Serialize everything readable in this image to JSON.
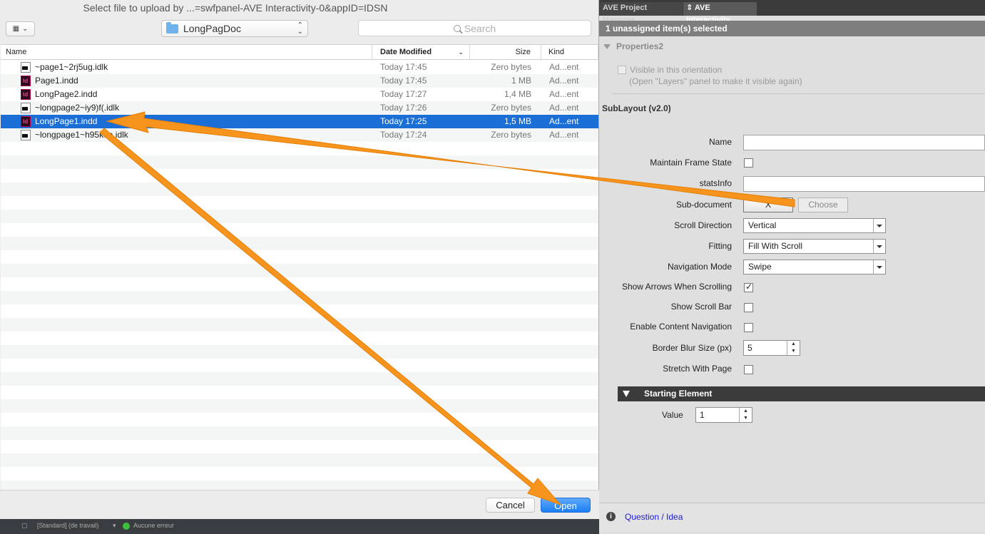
{
  "dialog": {
    "title": "Select file to upload by ...=swfpanel-AVE Interactivity-0&appID=IDSN",
    "location": "LongPagDoc",
    "search_placeholder": "Search",
    "columns": {
      "name": "Name",
      "date": "Date Modified",
      "size": "Size",
      "kind": "Kind"
    },
    "files": [
      {
        "name": "~page1~2rj5ug.idlk",
        "date": "Today 17:45",
        "size": "Zero bytes",
        "kind": "Ad...ent",
        "icon": "idlk-file-icon"
      },
      {
        "name": "Page1.indd",
        "date": "Today 17:45",
        "size": "1 MB",
        "kind": "Ad...ent",
        "icon": "indesign-file-icon"
      },
      {
        "name": "LongPage2.indd",
        "date": "Today 17:27",
        "size": "1,4 MB",
        "kind": "Ad...ent",
        "icon": "indesign-file-icon"
      },
      {
        "name": "~longpage2~iy9)f(.idlk",
        "date": "Today 17:26",
        "size": "Zero bytes",
        "kind": "Ad...ent",
        "icon": "idlk-file-icon"
      },
      {
        "name": "LongPage1.indd",
        "date": "Today 17:25",
        "size": "1,5 MB",
        "kind": "Ad...ent",
        "icon": "indesign-file-icon",
        "selected": true
      },
      {
        "name": "~longpage1~h95k8e.idlk",
        "date": "Today 17:24",
        "size": "Zero bytes",
        "kind": "Ad...ent",
        "icon": "idlk-file-icon"
      }
    ],
    "cancel_label": "Cancel",
    "open_label": "Open"
  },
  "status_strip": {
    "mode": "[Standard] (de travail)",
    "errors": "Aucune erreur"
  },
  "panel": {
    "tabs": [
      {
        "label": "AVE Project Manager"
      },
      {
        "label": "AVE Interactivity"
      }
    ],
    "selection": "1 unassigned item(s) selected",
    "properties_title": "Properties2",
    "visible_label": "Visible in this orientation",
    "visible_hint": "(Open \"Layers\" panel to make it visible again)",
    "sublayout_title": "SubLayout (v2.0)",
    "fields": {
      "name_label": "Name",
      "maintain_label": "Maintain Frame State",
      "stats_label": "statsInfo",
      "subdoc_label": "Sub-document",
      "x_label": "X",
      "choose_label": "Choose",
      "scroll_dir_label": "Scroll Direction",
      "scroll_dir_value": "Vertical",
      "fitting_label": "Fitting",
      "fitting_value": "Fill With Scroll",
      "nav_label": "Navigation Mode",
      "nav_value": "Swipe",
      "arrows_label": "Show Arrows When Scrolling",
      "scrollbar_label": "Show Scroll Bar",
      "content_nav_label": "Enable Content Navigation",
      "blur_label": "Border Blur Size (px)",
      "blur_value": "5",
      "stretch_label": "Stretch With Page"
    },
    "starting_element": "Starting Element",
    "value_label": "Value",
    "value_value": "1",
    "question_link": "Question / Idea"
  },
  "colors": {
    "selection": "#1a6ed6",
    "arrow": "#f7941d",
    "open_button": "#1b7ff3"
  }
}
